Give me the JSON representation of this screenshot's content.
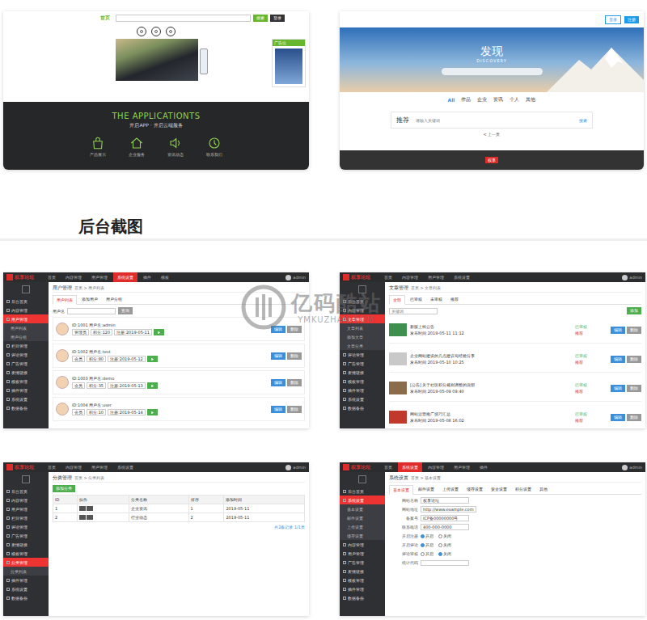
{
  "storefront_left": {
    "logo": "首页",
    "search_placeholder": "",
    "buttons": [
      "搜索",
      "登录"
    ],
    "ad_title": "广告位",
    "title": "THE APPLICATIONTS",
    "subtitle": "开启APP · 开启云端服务",
    "apps": [
      "产品展示",
      "企业服务",
      "资讯动态",
      "联系我们"
    ]
  },
  "storefront_right": {
    "buttons": [
      "登录",
      "注册"
    ],
    "title": "发现",
    "subtitle": "DISCOVERY",
    "search_placeholder": "",
    "nav": [
      {
        "label": "All",
        "selected": true
      },
      {
        "label": "作品",
        "selected": false
      },
      {
        "label": "企业",
        "selected": false
      },
      {
        "label": "资讯",
        "selected": false
      },
      {
        "label": "个人",
        "selected": false
      },
      {
        "label": "其他",
        "selected": false
      }
    ],
    "card_label": "推荐",
    "card_placeholder": "请输入关键词",
    "card_link": "搜索",
    "pager": "< 上一页",
    "footer_badge": "权享"
  },
  "heading": "后台截图",
  "watermark": {
    "name": "亿码酷站",
    "domain": "YMKUZHAN.COM"
  },
  "admin_screens": [
    {
      "kind": "users",
      "logo": "权享论坛",
      "nav": [
        {
          "label": "首页",
          "selected": false
        },
        {
          "label": "内容管理",
          "selected": false
        },
        {
          "label": "用户管理",
          "selected": false
        },
        {
          "label": "系统设置",
          "selected": true
        },
        {
          "label": "插件",
          "selected": false
        },
        {
          "label": "模板",
          "selected": false
        }
      ],
      "user": "admin",
      "sidebar": [
        {
          "label": "后台首页",
          "selected": false,
          "sub": false
        },
        {
          "label": "内容管理",
          "selected": false,
          "sub": false
        },
        {
          "label": "用户管理",
          "selected": true,
          "sub": false
        },
        {
          "label": "用户列表",
          "selected": false,
          "sub": true
        },
        {
          "label": "用户分组",
          "selected": false,
          "sub": true
        },
        {
          "label": "栏目管理",
          "selected": false,
          "sub": false
        },
        {
          "label": "评论管理",
          "selected": false,
          "sub": false
        },
        {
          "label": "广告管理",
          "selected": false,
          "sub": false
        },
        {
          "label": "友情链接",
          "selected": false,
          "sub": false
        },
        {
          "label": "模板管理",
          "selected": false,
          "sub": false
        },
        {
          "label": "插件管理",
          "selected": false,
          "sub": false
        },
        {
          "label": "系统设置",
          "selected": false,
          "sub": false
        },
        {
          "label": "数据备份",
          "selected": false,
          "sub": false
        }
      ],
      "title": "用户管理",
      "crumb": "首页 > 用户列表",
      "tabs": [
        {
          "label": "用户列表",
          "selected": true
        },
        {
          "label": "添加用户",
          "selected": false
        },
        {
          "label": "用户分组",
          "selected": false
        }
      ],
      "search_label": "用户名",
      "search_button": "查询",
      "rows": [
        {
          "line": "ID:1001 用户名:admin",
          "tags": [
            "管理员",
            "积分:120",
            "注册:2019-05-11"
          ],
          "buttons": [
            "编辑",
            "删除"
          ]
        },
        {
          "line": "ID:1002 用户名:test",
          "tags": [
            "会员",
            "积分:80",
            "注册:2019-05-12"
          ],
          "buttons": [
            "编辑",
            "删除"
          ]
        },
        {
          "line": "ID:1003 用户名:demo",
          "tags": [
            "会员",
            "积分:35",
            "注册:2019-05-13"
          ],
          "buttons": [
            "编辑",
            "删除"
          ]
        },
        {
          "line": "ID:1004 用户名:user",
          "tags": [
            "会员",
            "积分:10",
            "注册:2019-05-14"
          ],
          "buttons": [
            "编辑",
            "删除"
          ]
        }
      ]
    },
    {
      "kind": "articles",
      "logo": "权享论坛",
      "nav": [
        {
          "label": "首页",
          "selected": false
        },
        {
          "label": "内容管理",
          "selected": false
        },
        {
          "label": "用户管理",
          "selected": false
        },
        {
          "label": "系统设置",
          "selected": false
        }
      ],
      "user": "admin",
      "sidebar": [
        {
          "label": "后台首页",
          "selected": false,
          "sub": false
        },
        {
          "label": "内容管理",
          "selected": false,
          "sub": false
        },
        {
          "label": "文章管理",
          "selected": true,
          "sub": false
        },
        {
          "label": "文章列表",
          "selected": false,
          "sub": true
        },
        {
          "label": "添加文章",
          "selected": false,
          "sub": true
        },
        {
          "label": "文章分类",
          "selected": false,
          "sub": true
        },
        {
          "label": "评论管理",
          "selected": false,
          "sub": false
        },
        {
          "label": "广告管理",
          "selected": false,
          "sub": false
        },
        {
          "label": "友情链接",
          "selected": false,
          "sub": false
        },
        {
          "label": "模板管理",
          "selected": false,
          "sub": false
        },
        {
          "label": "插件管理",
          "selected": false,
          "sub": false
        },
        {
          "label": "系统设置",
          "selected": false,
          "sub": false
        },
        {
          "label": "数据备份",
          "selected": false,
          "sub": false
        }
      ],
      "title": "文章管理",
      "crumb": "首页 > 文章列表",
      "tabs": [
        {
          "label": "全部",
          "selected": true
        },
        {
          "label": "已审核",
          "selected": false
        },
        {
          "label": "未审核",
          "selected": false
        },
        {
          "label": "推荐",
          "selected": false
        }
      ],
      "search_placeholder": "关键词",
      "add_button": "添加",
      "rows": [
        {
          "title": "新版上线公告",
          "meta": "发布时间:2019-05-11 11:12",
          "status": "已审核",
          "flag": "推荐",
          "buttons": [
            "编辑",
            "删除"
          ]
        },
        {
          "title": "企业网站建设的几点建议与经验分享",
          "meta": "发布时间:2019-05-10 10:25",
          "status": "已审核",
          "flag": "推荐",
          "buttons": [
            "编辑",
            "删除"
          ]
        },
        {
          "title": "[公告] 关于社区积分规则调整的说明",
          "meta": "发布时间:2019-05-09 09:40",
          "status": "已审核",
          "flag": "推荐",
          "buttons": [
            "编辑",
            "删除"
          ]
        },
        {
          "title": "网站运营推广技巧汇总",
          "meta": "发布时间:2019-05-08 16:02",
          "status": "已审核",
          "flag": "推荐",
          "buttons": [
            "编辑",
            "删除"
          ]
        }
      ]
    },
    {
      "kind": "table",
      "logo": "权享论坛",
      "nav": [
        {
          "label": "首页",
          "selected": false
        },
        {
          "label": "内容管理",
          "selected": false
        },
        {
          "label": "用户管理",
          "selected": false
        },
        {
          "label": "系统设置",
          "selected": false
        }
      ],
      "user": "admin",
      "sidebar": [
        {
          "label": "后台首页",
          "selected": false,
          "sub": false
        },
        {
          "label": "内容管理",
          "selected": false,
          "sub": false
        },
        {
          "label": "用户管理",
          "selected": false,
          "sub": false
        },
        {
          "label": "栏目管理",
          "selected": false,
          "sub": false
        },
        {
          "label": "评论管理",
          "selected": false,
          "sub": false
        },
        {
          "label": "广告管理",
          "selected": false,
          "sub": false
        },
        {
          "label": "友情链接",
          "selected": false,
          "sub": false
        },
        {
          "label": "模板管理",
          "selected": false,
          "sub": false
        },
        {
          "label": "分类管理",
          "selected": true,
          "sub": false
        },
        {
          "label": "分类列表",
          "selected": false,
          "sub": true
        },
        {
          "label": "插件管理",
          "selected": false,
          "sub": false
        },
        {
          "label": "系统设置",
          "selected": false,
          "sub": false
        },
        {
          "label": "数据备份",
          "selected": false,
          "sub": false
        }
      ],
      "title": "分类管理",
      "crumb": "首页 > 分类列表",
      "add_button": "添加分类",
      "columns": [
        "ID",
        "操作",
        "分类名称",
        "排序",
        "添加时间"
      ],
      "rows": [
        [
          "1",
          "",
          "企业资讯",
          "1",
          "2019-05-11"
        ],
        [
          "2",
          "",
          "行业动态",
          "2",
          "2019-05-11"
        ]
      ],
      "pager": "共2条记录 1/1页"
    },
    {
      "kind": "form",
      "logo": "权享论坛",
      "nav": [
        {
          "label": "首页",
          "selected": false
        },
        {
          "label": "系统设置",
          "selected": true
        },
        {
          "label": "内容管理",
          "selected": false
        },
        {
          "label": "用户管理",
          "selected": false
        },
        {
          "label": "插件",
          "selected": false
        }
      ],
      "user": "admin",
      "sidebar": [
        {
          "label": "后台首页",
          "selected": false,
          "sub": false
        },
        {
          "label": "系统设置",
          "selected": true,
          "sub": false
        },
        {
          "label": "基本设置",
          "selected": false,
          "sub": true
        },
        {
          "label": "邮件设置",
          "selected": false,
          "sub": true
        },
        {
          "label": "上传设置",
          "selected": false,
          "sub": true
        },
        {
          "label": "缓存设置",
          "selected": false,
          "sub": true
        },
        {
          "label": "内容管理",
          "selected": false,
          "sub": false
        },
        {
          "label": "用户管理",
          "selected": false,
          "sub": false
        },
        {
          "label": "广告管理",
          "selected": false,
          "sub": false
        },
        {
          "label": "友情链接",
          "selected": false,
          "sub": false
        },
        {
          "label": "模板管理",
          "selected": false,
          "sub": false
        },
        {
          "label": "插件管理",
          "selected": false,
          "sub": false
        },
        {
          "label": "数据备份",
          "selected": false,
          "sub": false
        }
      ],
      "title": "系统设置",
      "crumb": "首页 > 基本设置",
      "tabs": [
        {
          "label": "基本设置",
          "selected": true
        },
        {
          "label": "邮件设置",
          "selected": false
        },
        {
          "label": "上传设置",
          "selected": false
        },
        {
          "label": "缓存设置",
          "selected": false
        },
        {
          "label": "安全设置",
          "selected": false
        },
        {
          "label": "积分设置",
          "selected": false
        },
        {
          "label": "其他",
          "selected": false
        }
      ],
      "fields": [
        {
          "kind": "text",
          "label": "网站名称",
          "value": "权享论坛"
        },
        {
          "kind": "text",
          "label": "网站地址",
          "value": "http://www.example.com"
        },
        {
          "kind": "text",
          "label": "备案号",
          "value": "ICP备00000000号"
        },
        {
          "kind": "text",
          "label": "联系电话",
          "value": "400-000-0000"
        },
        {
          "kind": "radio",
          "label": "开启注册",
          "options": [
            {
              "label": "开启",
              "selected": true
            },
            {
              "label": "关闭",
              "selected": false
            }
          ]
        },
        {
          "kind": "radio",
          "label": "开启评论",
          "options": [
            {
              "label": "开启",
              "selected": true
            },
            {
              "label": "关闭",
              "selected": false
            }
          ]
        },
        {
          "kind": "radio",
          "label": "评论审核",
          "options": [
            {
              "label": "开启",
              "selected": false
            },
            {
              "label": "关闭",
              "selected": true
            }
          ]
        },
        {
          "kind": "text",
          "label": "统计代码",
          "value": ""
        }
      ]
    }
  ]
}
